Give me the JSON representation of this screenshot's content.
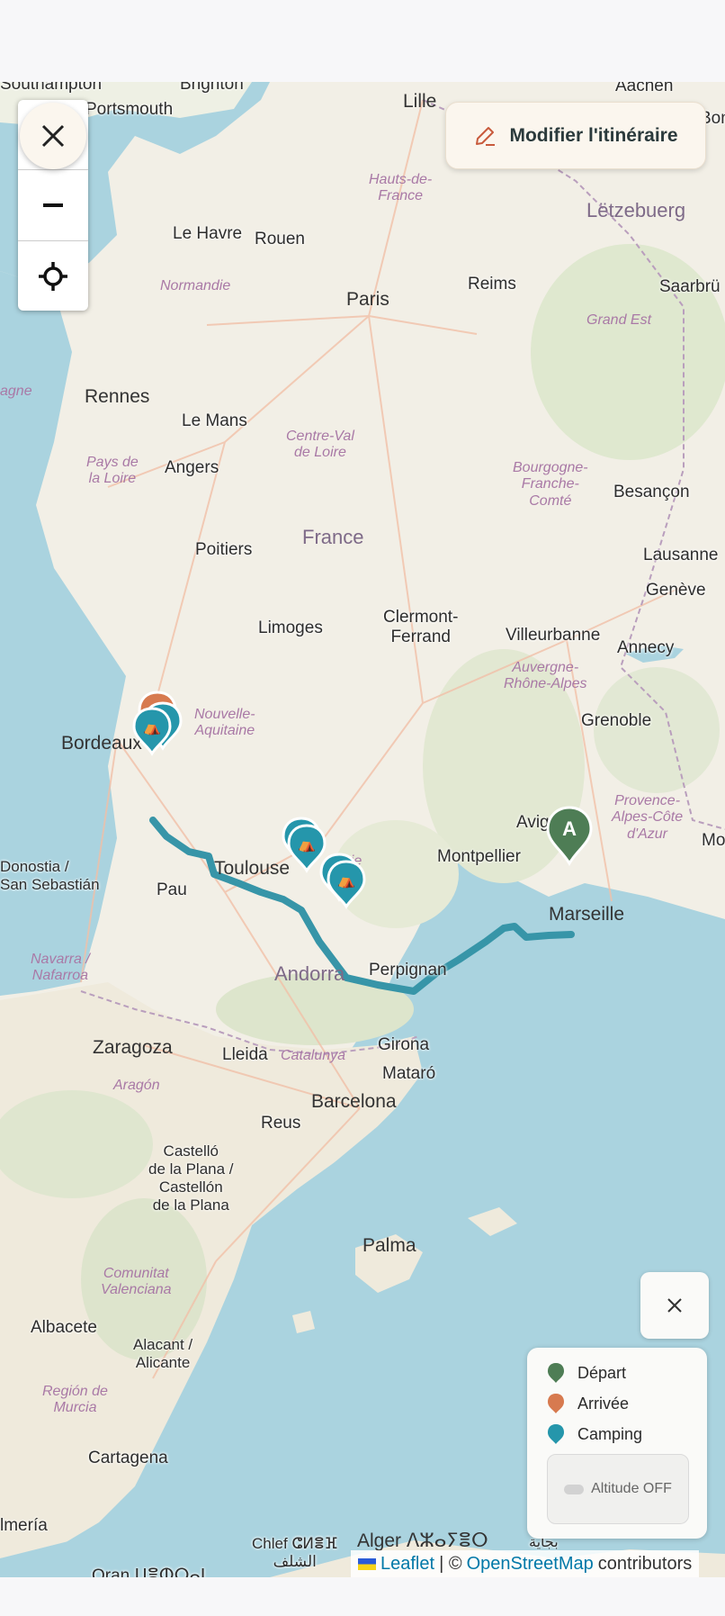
{
  "controls": {
    "close_icon": "close-icon",
    "zoom_out_icon": "minus-icon",
    "locate_icon": "crosshair-icon"
  },
  "edit_route": {
    "label": "Modifier l'itinéraire",
    "icon": "pencil-icon"
  },
  "map_labels": {
    "southampton": "Southampton",
    "brighton": "Brighton",
    "portsmouth": "Portsmouth",
    "lille": "Lille",
    "aachen": "Aachen",
    "bonn": "Bonn",
    "hauts_de_france": "Hauts-de-\nFrance",
    "letzebuerg": "Lëtzebuerg",
    "le_havre": "Le Havre",
    "rouen": "Rouen",
    "normandie": "Normandie",
    "paris": "Paris",
    "reims": "Reims",
    "saarbr": "Saarbrü",
    "grand_est": "Grand Est",
    "bretagne": "agne",
    "rennes": "Rennes",
    "le_mans": "Le Mans",
    "centre_val": "Centre-Val\nde Loire",
    "pays_loire": "Pays de\nla Loire",
    "angers": "Angers",
    "bourgogne": "Bourgogne-\nFranche-\nComté",
    "besancon": "Besançon",
    "france": "France",
    "poitiers": "Poitiers",
    "lausanne": "Lausanne",
    "geneve": "Genève",
    "limoges": "Limoges",
    "clermont": "Clermont-\nFerrand",
    "villeurbanne": "Villeurbanne",
    "annecy": "Annecy",
    "auvergne": "Auvergne-\nRhône-Alpes",
    "nouvelle_aquitaine": "Nouvelle-\nAquitaine",
    "grenoble": "Grenoble",
    "bordeaux": "Bordeaux",
    "avignon": "Avig",
    "provence": "Provence-\nAlpes-Côte\nd'Azur",
    "mo": "Mo",
    "toulouse": "Toulouse",
    "occitanie": "anie",
    "montpellier": "Montpellier",
    "donostia": "Donostia /\nSan Sebastián",
    "pau": "Pau",
    "marseille": "Marseille",
    "navarra": "Navarra /\nNafarroa",
    "andorra": "Andorra",
    "perpignan": "Perpignan",
    "zaragoza": "Zaragoza",
    "lleida": "Lleida",
    "catalunya": "Catalunya",
    "girona": "Girona",
    "aragon": "Aragón",
    "mataro": "Mataró",
    "reus": "Reus",
    "barcelona": "Barcelona",
    "castello": "Castelló\nde la Plana /\nCastellón\nde la Plana",
    "palma": "Palma",
    "comunitat": "Comunitat\nValenciana",
    "albacete": "Albacete",
    "alacant": "Alacant /\nAlicante",
    "murcia": "Región de\nMurcia",
    "cartagena": "Cartagena",
    "almeria": "lmería",
    "chlef": "Chlef ⵛⵍⴻⴼ\nالشلف",
    "alger": "Alger ⴷⵣⴰⵢⴻⵔ",
    "bejaia": "بجاية",
    "oran": "Oran ⵡⴻⵀⵔⴰⵏ"
  },
  "legend": {
    "close_icon": "close-icon",
    "items": [
      {
        "label": "Départ",
        "color": "#4e7d55"
      },
      {
        "label": "Arrivée",
        "color": "#d77a4f"
      },
      {
        "label": "Camping",
        "color": "#2596ab"
      }
    ],
    "altitude_label": "Altitude OFF"
  },
  "route_color": "#3795a8",
  "start_marker": {
    "letter": "A",
    "color": "#4e7d55"
  },
  "attribution": {
    "leaflet": "Leaflet",
    "separator": "| ©",
    "osm": "OpenStreetMap",
    "suffix": "contributors"
  }
}
